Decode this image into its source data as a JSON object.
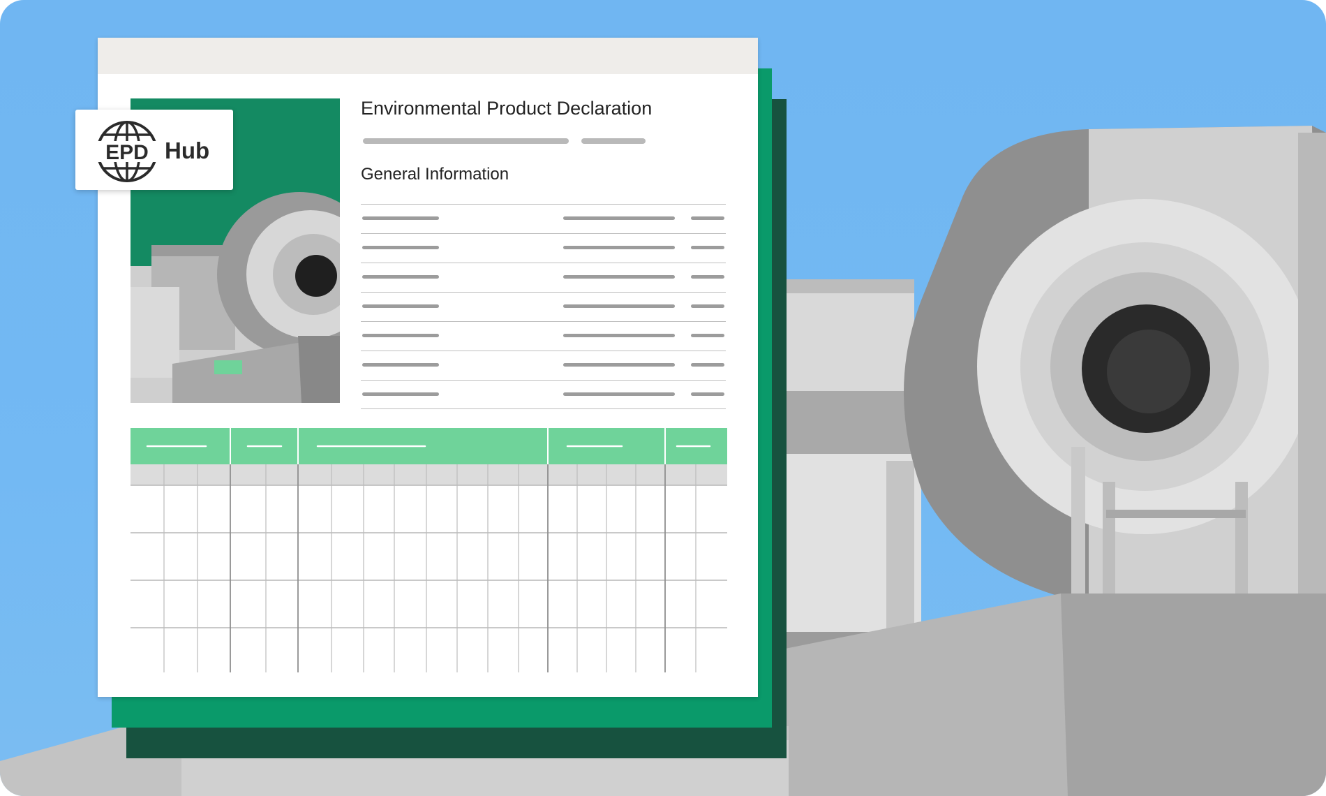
{
  "document": {
    "title": "Environmental Product Declaration",
    "section_title": "General Information"
  },
  "logo": {
    "mark_text": "EPD",
    "word": "Hub",
    "icon": "globe-icon"
  },
  "colors": {
    "sky": "#70b6f2",
    "green_sheet": "#0a9a6a",
    "dark_sheet": "#17523f",
    "table_header": "#6fd39a",
    "paper": "#ffffff",
    "topbar": "#efedea"
  }
}
